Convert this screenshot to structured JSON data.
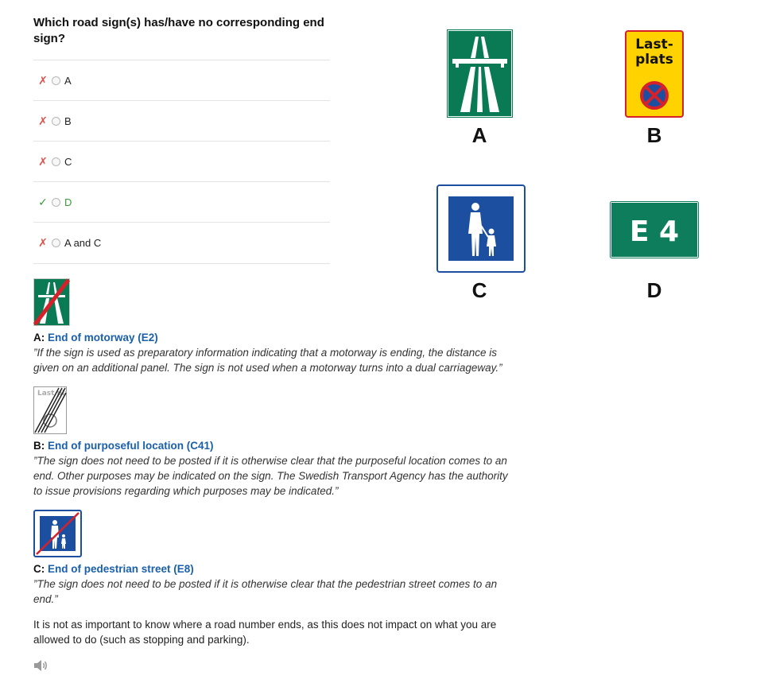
{
  "question": "Which road sign(s) has/have no corresponding end sign?",
  "options": [
    {
      "mark": "✗",
      "label": "A",
      "correct": false
    },
    {
      "mark": "✗",
      "label": "B",
      "correct": false
    },
    {
      "mark": "✗",
      "label": "C",
      "correct": false
    },
    {
      "mark": "✓",
      "label": "D",
      "correct": true
    },
    {
      "mark": "✗",
      "label": "A and C",
      "correct": false
    }
  ],
  "signs": {
    "a_label": "A",
    "b_label": "B",
    "c_label": "C",
    "d_label": "D",
    "b_text_line1": "Last-",
    "b_text_line2": "plats",
    "d_text": "E 4",
    "thumb_b_text": "Last plats"
  },
  "explanations": [
    {
      "prefix": "A: ",
      "link": "End of motorway (E2)",
      "quote": "”If the sign is used as preparatory information indicating that a motorway is ending, the distance is given on an additional panel. The sign is not used when a motorway turns into a dual carriageway.”"
    },
    {
      "prefix": "B: ",
      "link": "End of purposeful location (C41)",
      "quote": "”The sign does not need to be posted if it is otherwise clear that the purposeful location comes to an end. Other purposes may be indicated on the sign. The Swedish Transport Agency has the authority to issue provisions regarding which purposes may be indicated.”"
    },
    {
      "prefix": "C: ",
      "link": "End of pedestrian street (E8)",
      "quote": "”The sign does not need to be posted if it is otherwise clear that the pedestrian street comes to an end.”"
    }
  ],
  "note": "It is not as important to know where a road number ends, as this does not impact on what you are allowed to do (such as stopping and parking).",
  "colors": {
    "motorway_green": "#0a7a55",
    "route_green": "#0e7d5b",
    "sign_yellow": "#ffd200",
    "sign_red": "#d7212a",
    "sign_blue": "#1d4fa0",
    "link_blue": "#1a5faa",
    "wrong_red": "#d9534f",
    "right_green": "#3c9a3c"
  },
  "icons": [
    "motorway-sign-icon",
    "loading-place-sign-icon",
    "pedestrian-street-sign-icon",
    "route-e4-sign-icon",
    "speaker-icon"
  ]
}
